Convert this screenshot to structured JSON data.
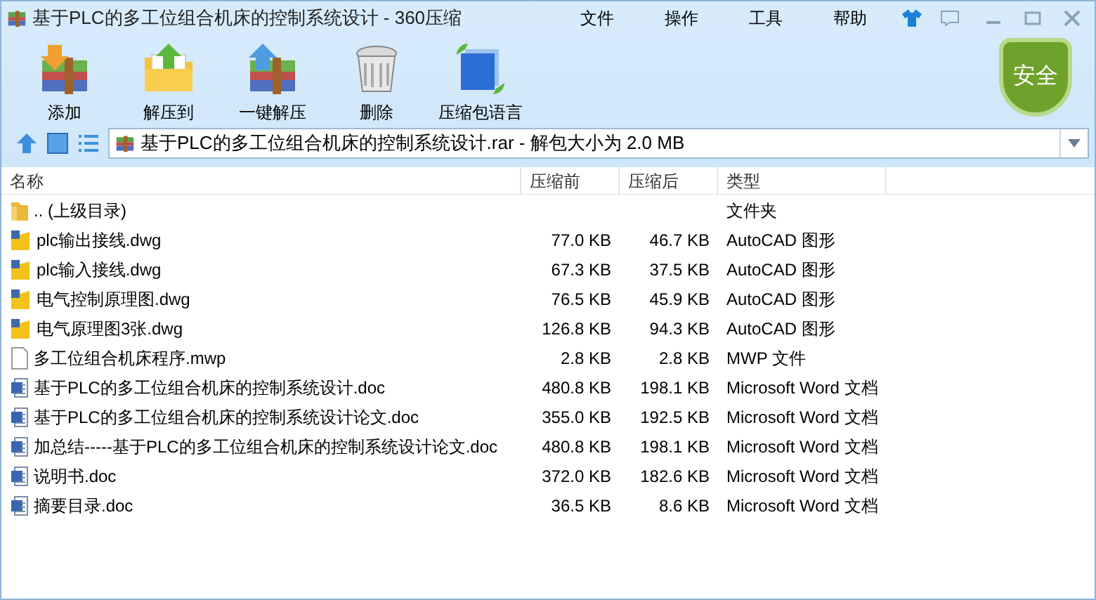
{
  "window": {
    "title": "基于PLC的多工位组合机床的控制系统设计 - 360压缩"
  },
  "menu": [
    "文件",
    "操作",
    "工具",
    "帮助"
  ],
  "toolbar": [
    {
      "kind": "add",
      "label": "添加"
    },
    {
      "kind": "extract",
      "label": "解压到"
    },
    {
      "kind": "oneclick",
      "label": "一键解压"
    },
    {
      "kind": "delete",
      "label": "删除"
    },
    {
      "kind": "language",
      "label": "压缩包语言"
    }
  ],
  "security_badge": "安全",
  "address": "基于PLC的多工位组合机床的控制系统设计.rar - 解包大小为 2.0 MB",
  "table": {
    "columns": [
      "名称",
      "压缩前",
      "压缩后",
      "类型"
    ],
    "rows": [
      {
        "kind": "folder",
        "name": ".. (上级目录)",
        "before": "",
        "after": "",
        "type": "文件夹"
      },
      {
        "kind": "dwg",
        "name": "plc输出接线.dwg",
        "before": "77.0 KB",
        "after": "46.7 KB",
        "type": "AutoCAD 图形"
      },
      {
        "kind": "dwg",
        "name": "plc输入接线.dwg",
        "before": "67.3 KB",
        "after": "37.5 KB",
        "type": "AutoCAD 图形"
      },
      {
        "kind": "dwg",
        "name": "电气控制原理图.dwg",
        "before": "76.5 KB",
        "after": "45.9 KB",
        "type": "AutoCAD 图形"
      },
      {
        "kind": "dwg",
        "name": "电气原理图3张.dwg",
        "before": "126.8 KB",
        "after": "94.3 KB",
        "type": "AutoCAD 图形"
      },
      {
        "kind": "file",
        "name": "多工位组合机床程序.mwp",
        "before": "2.8 KB",
        "after": "2.8 KB",
        "type": "MWP 文件"
      },
      {
        "kind": "doc",
        "name": "基于PLC的多工位组合机床的控制系统设计.doc",
        "before": "480.8 KB",
        "after": "198.1 KB",
        "type": "Microsoft Word 文档"
      },
      {
        "kind": "doc",
        "name": "基于PLC的多工位组合机床的控制系统设计论文.doc",
        "before": "355.0 KB",
        "after": "192.5 KB",
        "type": "Microsoft Word 文档"
      },
      {
        "kind": "doc",
        "name": "加总结-----基于PLC的多工位组合机床的控制系统设计论文.doc",
        "before": "480.8 KB",
        "after": "198.1 KB",
        "type": "Microsoft Word 文档"
      },
      {
        "kind": "doc",
        "name": "说明书.doc",
        "before": "372.0 KB",
        "after": "182.6 KB",
        "type": "Microsoft Word 文档"
      },
      {
        "kind": "doc",
        "name": "摘要目录.doc",
        "before": "36.5 KB",
        "after": "8.6 KB",
        "type": "Microsoft Word 文档"
      }
    ]
  }
}
